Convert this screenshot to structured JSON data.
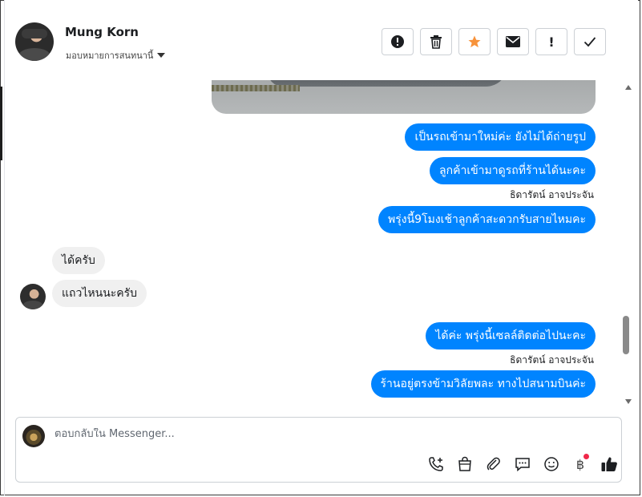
{
  "header": {
    "contact_name": "Mung Korn",
    "assign_label": "มอบหมายการสนทนานี้",
    "actions": [
      {
        "icon": "exclamation-circle-icon"
      },
      {
        "icon": "trash-icon"
      },
      {
        "icon": "star-icon",
        "color": "#f7923a"
      },
      {
        "icon": "mail-icon"
      },
      {
        "icon": "exclamation-icon",
        "text": "!"
      },
      {
        "icon": "check-icon"
      }
    ]
  },
  "conversation": {
    "messages": [
      {
        "direction": "out",
        "text": "เป็นรถเข้ามาใหม่ค่ะ ยังไม่ได้ถ่ายรูป"
      },
      {
        "direction": "out",
        "text": "ลูกค้าเข้ามาดูรถที่ร้านได้นะคะ"
      },
      {
        "direction": "out",
        "text": "พรุ่งนี้9โมงเช้าลูกค้าสะดวกรับสายไหมคะ"
      },
      {
        "direction": "in",
        "text": "ได้ครับ"
      },
      {
        "direction": "in",
        "text": "แถวไหนนะครับ"
      },
      {
        "direction": "out",
        "text": "ได้ค่ะ พรุ่งนี้เซลล์ติดต่อไปนะคะ"
      },
      {
        "direction": "out",
        "text": "ร้านอยู่ตรงข้ามวิลัยพละ ทางไปสนามบินค่ะ"
      }
    ],
    "sender_labels": [
      "ธิดารัตน์ อาจประจัน",
      "ธิดารัตน์ อาจประจัน"
    ]
  },
  "composer": {
    "placeholder": "ตอบกลับใน Messenger...",
    "tools": [
      "phone-add-icon",
      "shopping-bag-icon",
      "paperclip-icon",
      "saved-reply-icon",
      "emoji-icon",
      "baht-icon",
      "thumbs-up-icon"
    ],
    "baht_symbol": "฿"
  },
  "colors": {
    "outgoing_bubble": "#0084ff",
    "incoming_bubble": "#f0f0f0",
    "star": "#f7923a",
    "notification_dot": "#f02849"
  }
}
